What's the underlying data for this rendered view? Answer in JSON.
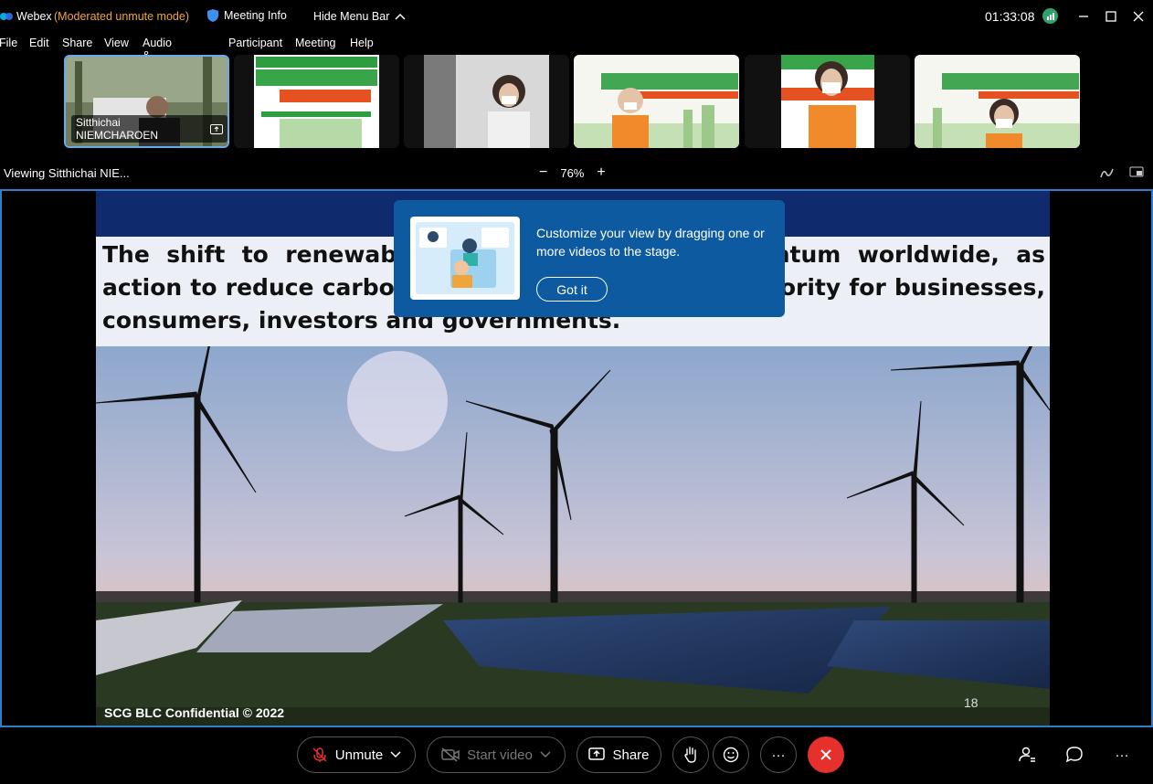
{
  "titlebar": {
    "app_name": "Webex",
    "mode": "(Moderated unmute mode)",
    "meeting_info": "Meeting Info",
    "hide_menu": "Hide Menu Bar",
    "clock": "01:33:08"
  },
  "menu": {
    "file": "File",
    "edit": "Edit",
    "share": "Share",
    "view": "View",
    "audio_video": "Audio & Video",
    "participant": "Participant",
    "meeting": "Meeting",
    "help": "Help"
  },
  "filmstrip": {
    "active_name": "Sitthichai NIEMCHAROEN"
  },
  "zoom_bar": {
    "viewing": "Viewing Sitthichai NIE...",
    "minus": "−",
    "zoom_level": "76%",
    "plus": "+"
  },
  "slide": {
    "body_text": "The shift to renewable energy is gaining momentum worldwide, as action to reduce carbon emissions remains a key priority for businesses, consumers, investors and governments.",
    "footer": "SCG BLC Confidential © 2022",
    "page_number": "18"
  },
  "popup": {
    "message": "Customize your view by dragging one or more videos to the stage.",
    "button": "Got it"
  },
  "controls": {
    "unmute": "Unmute",
    "start_video": "Start video",
    "share": "Share",
    "more": "···"
  },
  "colors": {
    "accent_blue": "#2d7fc9",
    "mode_orange": "#f0a63a",
    "end_red": "#e5302c",
    "popup_blue": "#0d5aa1"
  }
}
